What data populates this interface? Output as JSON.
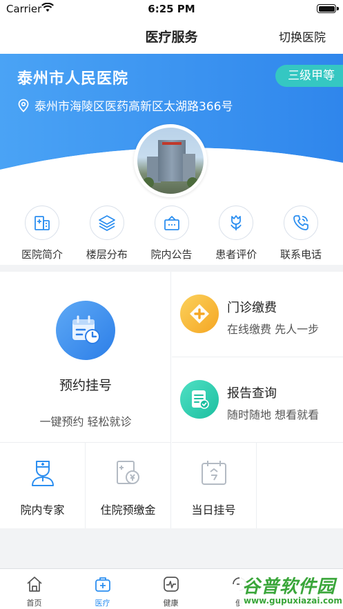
{
  "status_bar": {
    "carrier": "Carrier",
    "time": "6:25 PM"
  },
  "nav": {
    "title": "医疗服务",
    "action": "切换医院"
  },
  "hospital": {
    "name": "泰州市人民医院",
    "level": "三级甲等",
    "address": "泰州市海陵区医药高新区太湖路366号"
  },
  "quick_menu": [
    {
      "label": "医院简介",
      "icon": "hospital-building-icon"
    },
    {
      "label": "楼层分布",
      "icon": "layers-icon"
    },
    {
      "label": "院内公告",
      "icon": "notice-board-icon"
    },
    {
      "label": "患者评价",
      "icon": "tulip-icon"
    },
    {
      "label": "联系电话",
      "icon": "phone-icon"
    }
  ],
  "services": {
    "appointment": {
      "title": "预约挂号",
      "subtitle": "一键预约 轻松就诊",
      "icon": "calendar-clock-icon"
    },
    "payment": {
      "title": "门诊缴费",
      "subtitle": "在线缴费 先人一步",
      "icon": "medical-plus-icon"
    },
    "report": {
      "title": "报告查询",
      "subtitle": "随时随地 想看就看",
      "icon": "report-check-icon"
    },
    "small": [
      {
        "label": "院内专家",
        "icon": "doctor-icon"
      },
      {
        "label": "住院预缴金",
        "icon": "deposit-icon"
      },
      {
        "label": "当日挂号",
        "icon": "today-calendar-icon"
      }
    ]
  },
  "tabs": [
    {
      "label": "首页",
      "icon": "home-icon"
    },
    {
      "label": "医疗",
      "icon": "medical-kit-icon",
      "active": true
    },
    {
      "label": "健康",
      "icon": "heart-rate-icon"
    },
    {
      "label": "便",
      "icon": "convenience-icon"
    },
    {
      "label": "",
      "icon": ""
    }
  ],
  "watermark": {
    "logo": "谷普软件园",
    "url": "www.gupuxiazai.com"
  },
  "colors": {
    "primary": "#2b8ef0",
    "teal": "#35c7c2",
    "orange": "#f7b733"
  }
}
